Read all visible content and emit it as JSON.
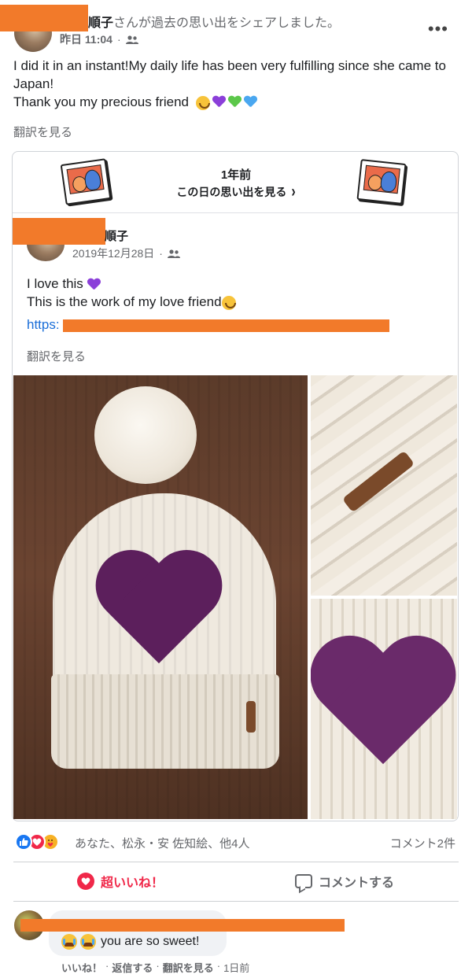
{
  "header": {
    "author_visible": "順子",
    "share_text": "さんが過去の思い出をシェアしました。",
    "time": "昨日 11:04",
    "separator": "·",
    "audience_icon": "friends-icon",
    "more_icon": "more-icon",
    "more_glyph": "•••"
  },
  "post": {
    "line1": "I did it in an instant!My daily life has been very fulfilling since she came to Japan!",
    "line2": "Thank you my precious friend",
    "translate": "翻訳を見る"
  },
  "memory": {
    "years_ago": "1年前",
    "see_memories": "この日の思い出を見る",
    "chevron": "›",
    "original": {
      "author_visible": "順子",
      "date": "2019年12月28日",
      "separator": "·",
      "text_line1": "I love this",
      "text_line2": "This is the work of my love friend",
      "link_prefix": "https:",
      "translate": "翻訳を見る"
    }
  },
  "reactions": {
    "names": "あなた、松永・安 佐知絵、他4人",
    "comment_count": "コメント2件",
    "icons": [
      "like-icon",
      "love-icon",
      "care-icon"
    ]
  },
  "actions": {
    "love_label": "超いいね！",
    "comment_label": "コメントする"
  },
  "comment": {
    "text": "you are so sweet!",
    "like": "いいね！",
    "reply": "返信する",
    "translate": "翻訳を見る",
    "time": "1日前",
    "dot": "·"
  },
  "colors": {
    "redaction": "#f27a2a",
    "love_red": "#f02849",
    "link_blue": "#1a6ed8",
    "like_blue": "#1877f2"
  }
}
